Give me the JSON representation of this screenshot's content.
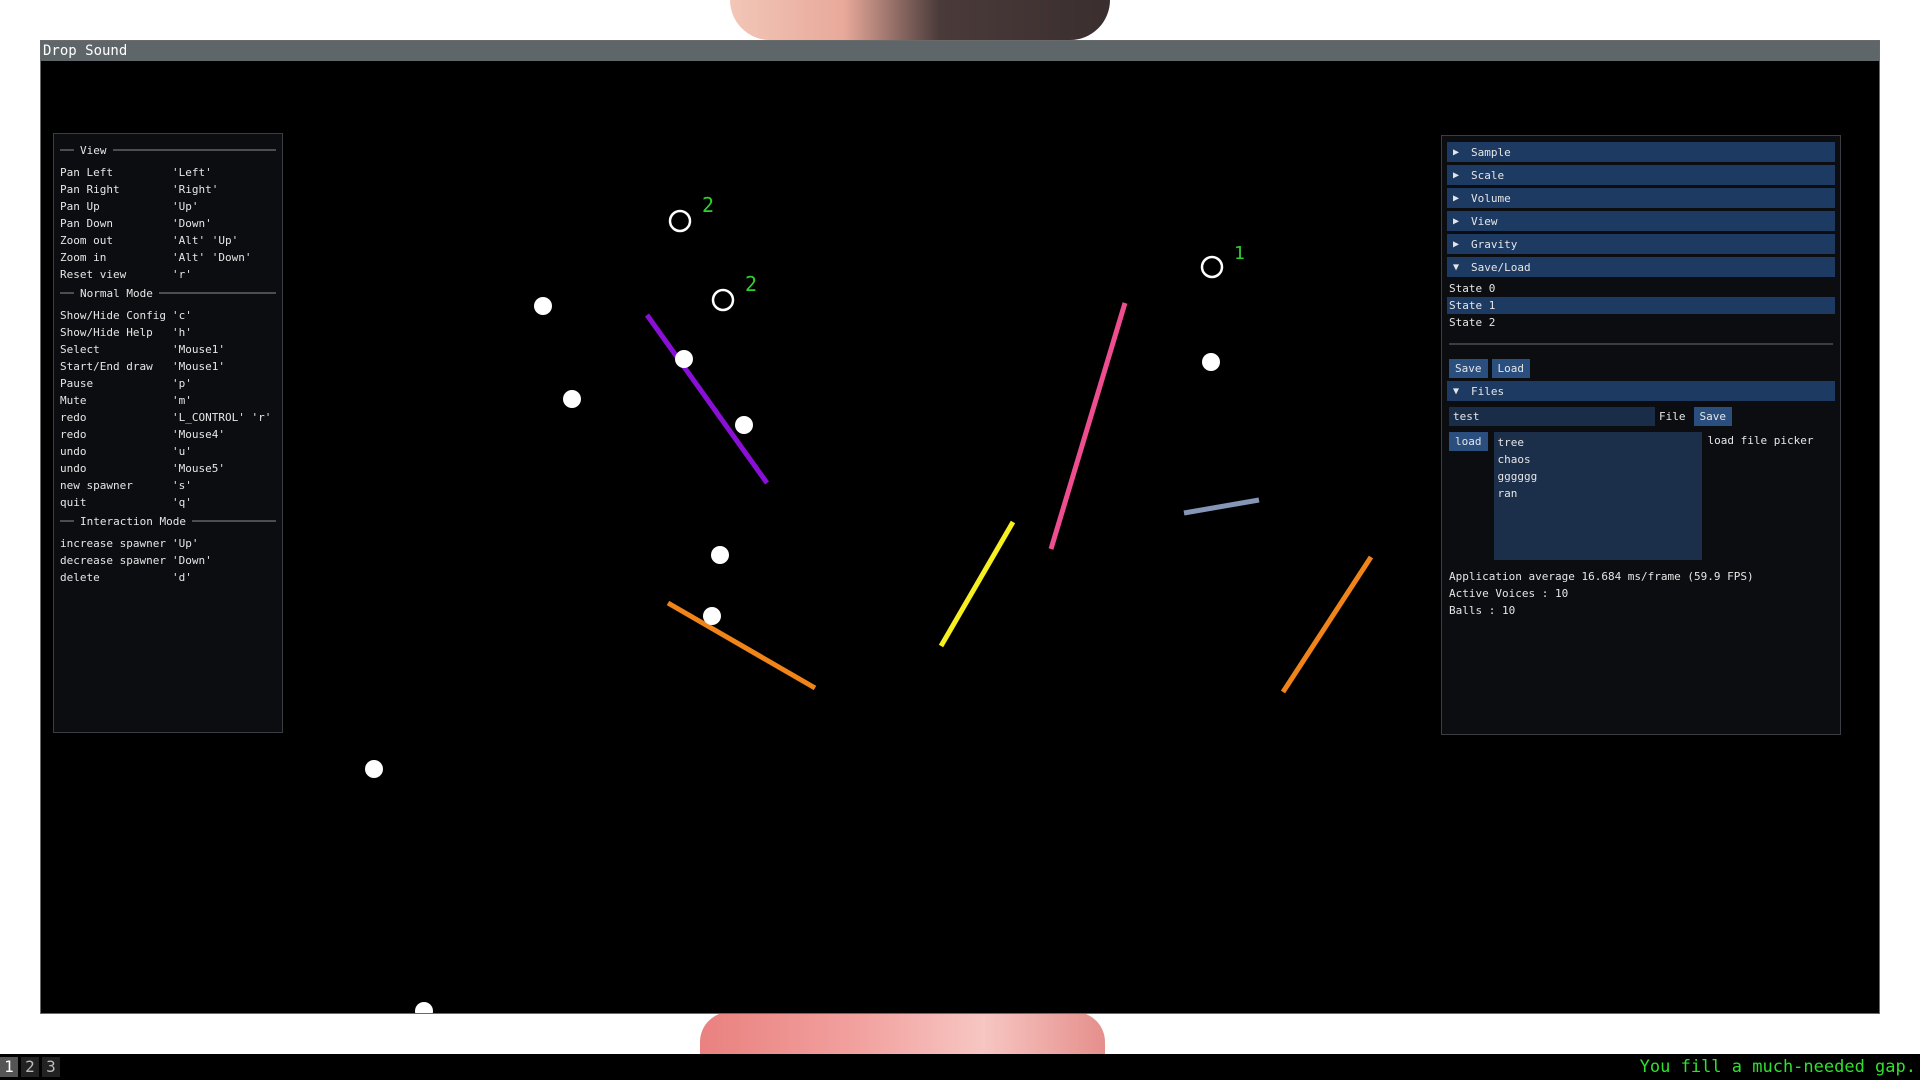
{
  "window": {
    "title": "Drop Sound"
  },
  "help": {
    "sections": [
      {
        "title": "View",
        "rows": [
          [
            "Pan Left",
            "'Left'"
          ],
          [
            "Pan Right",
            "'Right'"
          ],
          [
            "Pan Up",
            "'Up'"
          ],
          [
            "Pan Down",
            "'Down'"
          ],
          [
            "Zoom out",
            "'Alt' 'Up'"
          ],
          [
            "Zoom in",
            "'Alt' 'Down'"
          ],
          [
            "Reset view",
            "'r'"
          ]
        ]
      },
      {
        "title": "Normal Mode",
        "rows": [
          [
            "Show/Hide Config",
            "'c'"
          ],
          [
            "Show/Hide Help",
            "'h'"
          ],
          [
            "Select",
            "'Mouse1'"
          ],
          [
            "Start/End draw",
            "'Mouse1'"
          ],
          [
            "Pause",
            "'p'"
          ],
          [
            "Mute",
            "'m'"
          ],
          [
            "redo",
            "'L_CONTROL' 'r'"
          ],
          [
            "redo",
            "'Mouse4'"
          ],
          [
            "undo",
            "'u'"
          ],
          [
            "undo",
            "'Mouse5'"
          ],
          [
            "new spawner",
            "'s'"
          ],
          [
            "quit",
            "'q'"
          ]
        ]
      },
      {
        "title": "Interaction Mode",
        "rows": [
          [
            "increase spawner",
            "'Up'"
          ],
          [
            "decrease spawner",
            "'Down'"
          ],
          [
            "delete",
            "'d'"
          ]
        ]
      }
    ]
  },
  "config": {
    "headers": [
      {
        "label": "Sample",
        "open": false
      },
      {
        "label": "Scale",
        "open": false
      },
      {
        "label": "Volume",
        "open": false
      },
      {
        "label": "View",
        "open": false
      },
      {
        "label": "Gravity",
        "open": false
      },
      {
        "label": "Save/Load",
        "open": true
      }
    ],
    "states": [
      "State 0",
      "State 1",
      "State 2"
    ],
    "selected_state": 1,
    "save_label": "Save",
    "load_label": "Load",
    "files_header": "Files",
    "file_input_value": "test",
    "file_label": "File",
    "file_save_label": "Save",
    "file_load_label": "load",
    "files": [
      "tree",
      "chaos",
      "gggggg",
      "ran"
    ],
    "load_picker_label": "load file picker",
    "stats": [
      "Application average 16.684 ms/frame (59.9 FPS)",
      "Active Voices : 10",
      "Balls : 10"
    ]
  },
  "scene": {
    "spawners": [
      {
        "label": "2",
        "color": "#2fd12f"
      },
      {
        "label": "2",
        "color": "#2fd12f"
      },
      {
        "label": "1",
        "color": "#2fd12f"
      }
    ],
    "line_colors": [
      "#8a10d8",
      "#ee4d8f",
      "#f7f020",
      "#f08418",
      "#8596b6",
      "#f08418"
    ]
  },
  "taskbar": {
    "workspaces": [
      "1",
      "2",
      "3"
    ],
    "active_workspace": "1",
    "message": "You fill a much-needed gap."
  }
}
